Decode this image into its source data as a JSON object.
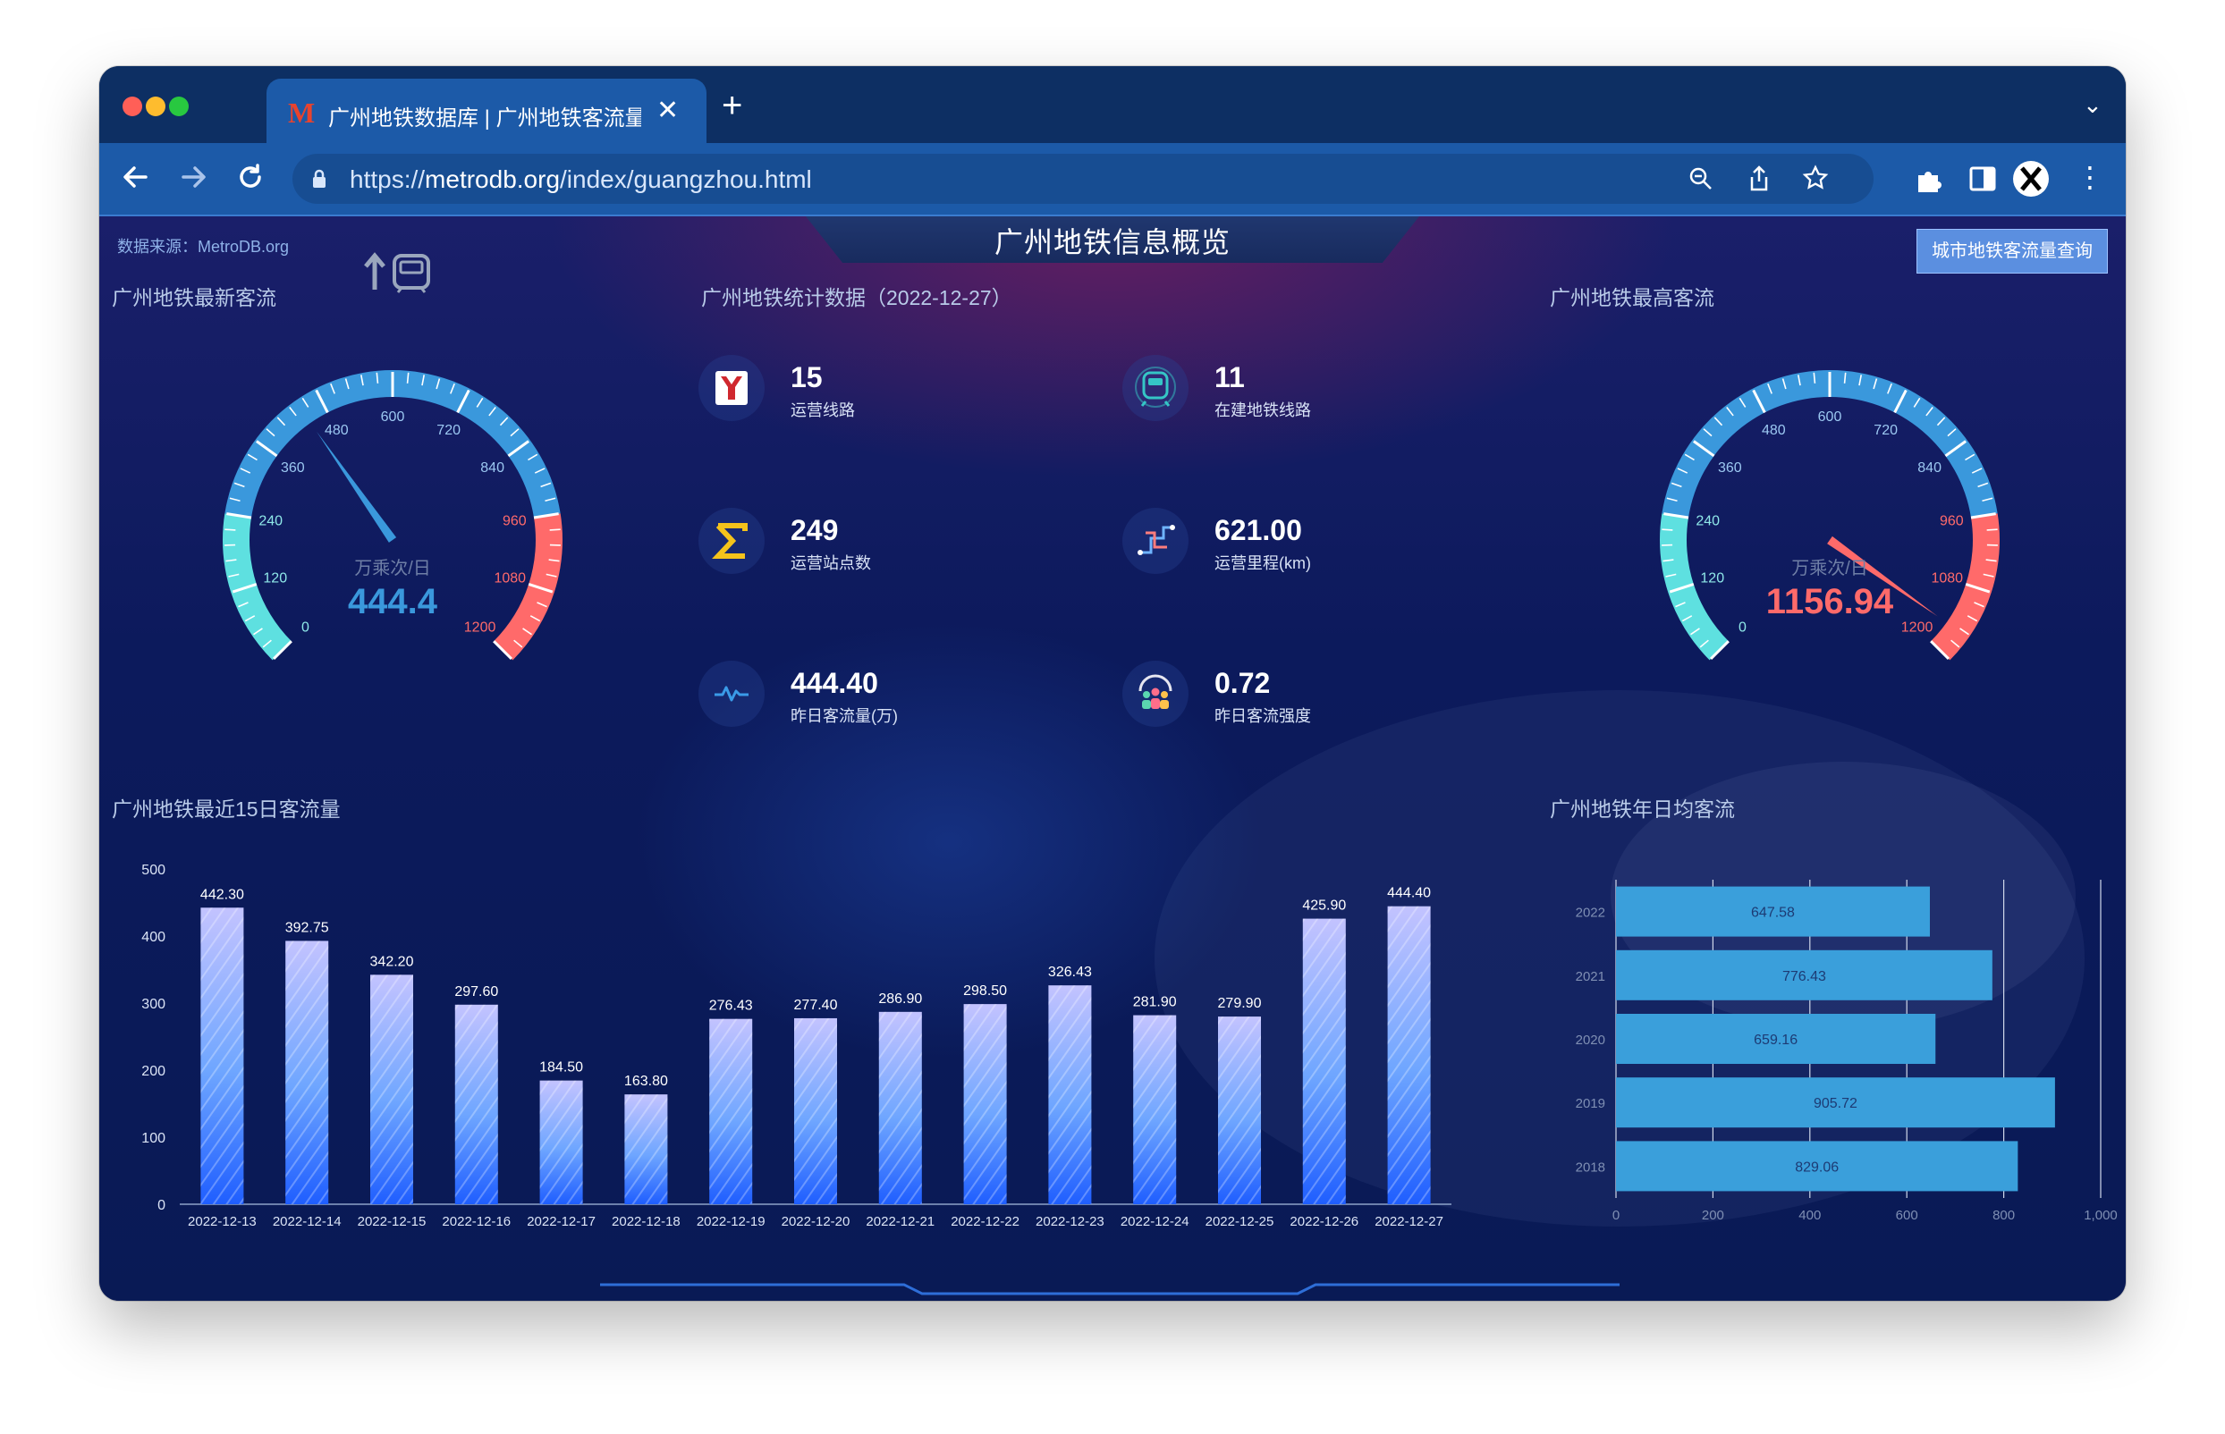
{
  "browser": {
    "tab_title": "广州地铁数据库 | 广州地铁客流量",
    "favicon_letter": "M",
    "url_prefix": "https://",
    "url_domain": "metrodb.org",
    "url_path": "/index/guangzhou.html"
  },
  "page": {
    "title": "广州地铁信息概览",
    "source": "数据来源：MetroDB.org",
    "query_button": "城市地铁客流量查询"
  },
  "sections": {
    "latest": "广州地铁最新客流",
    "stats": "广州地铁统计数据（2022-12-27）",
    "highest": "广州地铁最高客流",
    "recent15": "广州地铁最近15日客流量",
    "yearly": "广州地铁年日均客流"
  },
  "gauges": {
    "unit": "万乘次/日",
    "ticks": [
      "0",
      "120",
      "240",
      "360",
      "480",
      "600",
      "720",
      "840",
      "960",
      "1080",
      "1200"
    ],
    "latest_value": "444.4",
    "latest_num": 444.4,
    "highest_value": "1156.94",
    "highest_num": 1156.94,
    "max": 1200,
    "colors": {
      "low": "#5ee0e0",
      "mid": "#3a98dc",
      "high": "#ff6a6a"
    }
  },
  "stats": [
    {
      "value": "15",
      "label": "运营线路",
      "icon": "metro-logo-icon"
    },
    {
      "value": "11",
      "label": "在建地铁线路",
      "icon": "train-icon"
    },
    {
      "value": "249",
      "label": "运营站点数",
      "icon": "sigma-icon"
    },
    {
      "value": "621.00",
      "label": "运营里程(km)",
      "icon": "route-icon"
    },
    {
      "value": "444.40",
      "label": "昨日客流量(万)",
      "icon": "pulse-icon"
    },
    {
      "value": "0.72",
      "label": "昨日客流强度",
      "icon": "people-icon"
    }
  ],
  "chart_data": [
    {
      "type": "bar",
      "categories": [
        "2022-12-13",
        "2022-12-14",
        "2022-12-15",
        "2022-12-16",
        "2022-12-17",
        "2022-12-18",
        "2022-12-19",
        "2022-12-20",
        "2022-12-21",
        "2022-12-22",
        "2022-12-23",
        "2022-12-24",
        "2022-12-25",
        "2022-12-26",
        "2022-12-27"
      ],
      "values": [
        442.3,
        392.75,
        342.2,
        297.6,
        184.5,
        163.8,
        276.43,
        277.4,
        286.9,
        298.5,
        326.43,
        281.9,
        279.9,
        425.9,
        444.4
      ],
      "value_labels": [
        "442.30",
        "392.75",
        "342.20",
        "297.60",
        "184.50",
        "163.80",
        "276.43",
        "277.40",
        "286.90",
        "298.50",
        "326.43",
        "281.90",
        "279.90",
        "425.90",
        "444.40"
      ],
      "y_ticks": [
        "0",
        "100",
        "200",
        "300",
        "400",
        "500"
      ],
      "ylim": [
        0,
        500
      ],
      "grid": false
    },
    {
      "type": "bar",
      "orientation": "horizontal",
      "categories": [
        "2022",
        "2021",
        "2020",
        "2019",
        "2018"
      ],
      "values": [
        647.58,
        776.43,
        659.16,
        905.72,
        829.06
      ],
      "value_labels": [
        "647.58",
        "776.43",
        "659.16",
        "905.72",
        "829.06"
      ],
      "x_ticks": [
        "0",
        "200",
        "400",
        "600",
        "800",
        "1,000"
      ],
      "xlim": [
        0,
        1000
      ],
      "grid": true
    }
  ]
}
